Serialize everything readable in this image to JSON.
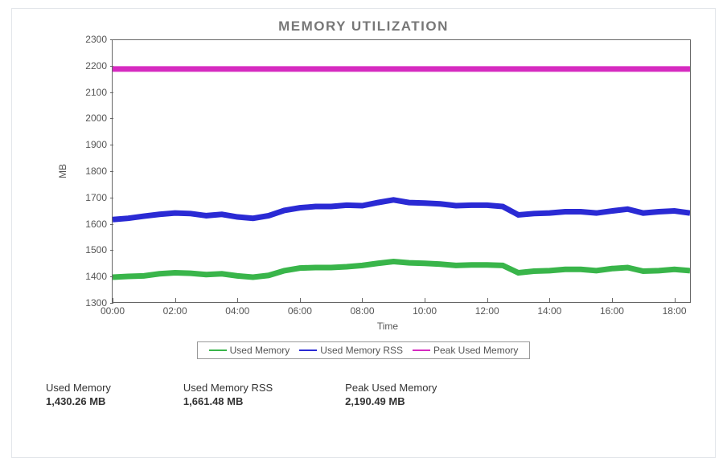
{
  "title": "MEMORY UTILIZATION",
  "ylabel": "MB",
  "xlabel": "Time",
  "legend": {
    "used": "Used Memory",
    "rss": "Used Memory RSS",
    "peak": "Peak Used Memory"
  },
  "stats": {
    "used_label": "Used Memory",
    "used_val": "1,430.26 MB",
    "rss_label": "Used Memory RSS",
    "rss_val": "1,661.48 MB",
    "peak_label": "Peak Used Memory",
    "peak_val": "2,190.49 MB"
  },
  "colors": {
    "used": "#39b54a",
    "rss": "#2a2ad4",
    "peak": "#d62bc0"
  },
  "chart_data": {
    "type": "line",
    "xlabel": "Time",
    "ylabel": "MB",
    "ylim": [
      1300,
      2300
    ],
    "x_ticks": [
      "00:00",
      "02:00",
      "04:00",
      "06:00",
      "08:00",
      "10:00",
      "12:00",
      "14:00",
      "16:00",
      "18:00"
    ],
    "y_ticks": [
      1300,
      1400,
      1500,
      1600,
      1700,
      1800,
      1900,
      2000,
      2100,
      2200,
      2300
    ],
    "x_range_hours": [
      0,
      18.5
    ],
    "series": [
      {
        "name": "Peak Used Memory",
        "color": "#d62bc0",
        "x": [
          0,
          18.5
        ],
        "y": [
          2190,
          2190
        ]
      },
      {
        "name": "Used Memory RSS",
        "color": "#2a2ad4",
        "x": [
          0,
          0.5,
          1,
          1.5,
          2,
          2.5,
          3,
          3.5,
          4,
          4.5,
          5,
          5.5,
          6,
          6.5,
          7,
          7.5,
          8,
          8.5,
          9,
          9.5,
          10,
          10.5,
          11,
          11.5,
          12,
          12.5,
          13,
          13.5,
          14,
          14.5,
          15,
          15.5,
          16,
          16.5,
          17,
          17.5,
          18,
          18.5
        ],
        "y": [
          1615,
          1620,
          1628,
          1635,
          1640,
          1638,
          1630,
          1635,
          1625,
          1620,
          1630,
          1650,
          1660,
          1665,
          1665,
          1670,
          1668,
          1680,
          1690,
          1680,
          1678,
          1675,
          1668,
          1670,
          1670,
          1665,
          1633,
          1638,
          1640,
          1645,
          1645,
          1640,
          1648,
          1655,
          1640,
          1645,
          1648,
          1640
        ]
      },
      {
        "name": "Used Memory",
        "color": "#39b54a",
        "x": [
          0,
          0.5,
          1,
          1.5,
          2,
          2.5,
          3,
          3.5,
          4,
          4.5,
          5,
          5.5,
          6,
          6.5,
          7,
          7.5,
          8,
          8.5,
          9,
          9.5,
          10,
          10.5,
          11,
          11.5,
          12,
          12.5,
          13,
          13.5,
          14,
          14.5,
          15,
          15.5,
          16,
          16.5,
          17,
          17.5,
          18,
          18.5
        ],
        "y": [
          1395,
          1398,
          1400,
          1408,
          1412,
          1410,
          1405,
          1408,
          1400,
          1395,
          1402,
          1420,
          1430,
          1432,
          1432,
          1435,
          1440,
          1448,
          1455,
          1450,
          1448,
          1445,
          1440,
          1442,
          1442,
          1440,
          1412,
          1418,
          1420,
          1425,
          1425,
          1420,
          1428,
          1432,
          1418,
          1420,
          1425,
          1420
        ]
      }
    ]
  }
}
